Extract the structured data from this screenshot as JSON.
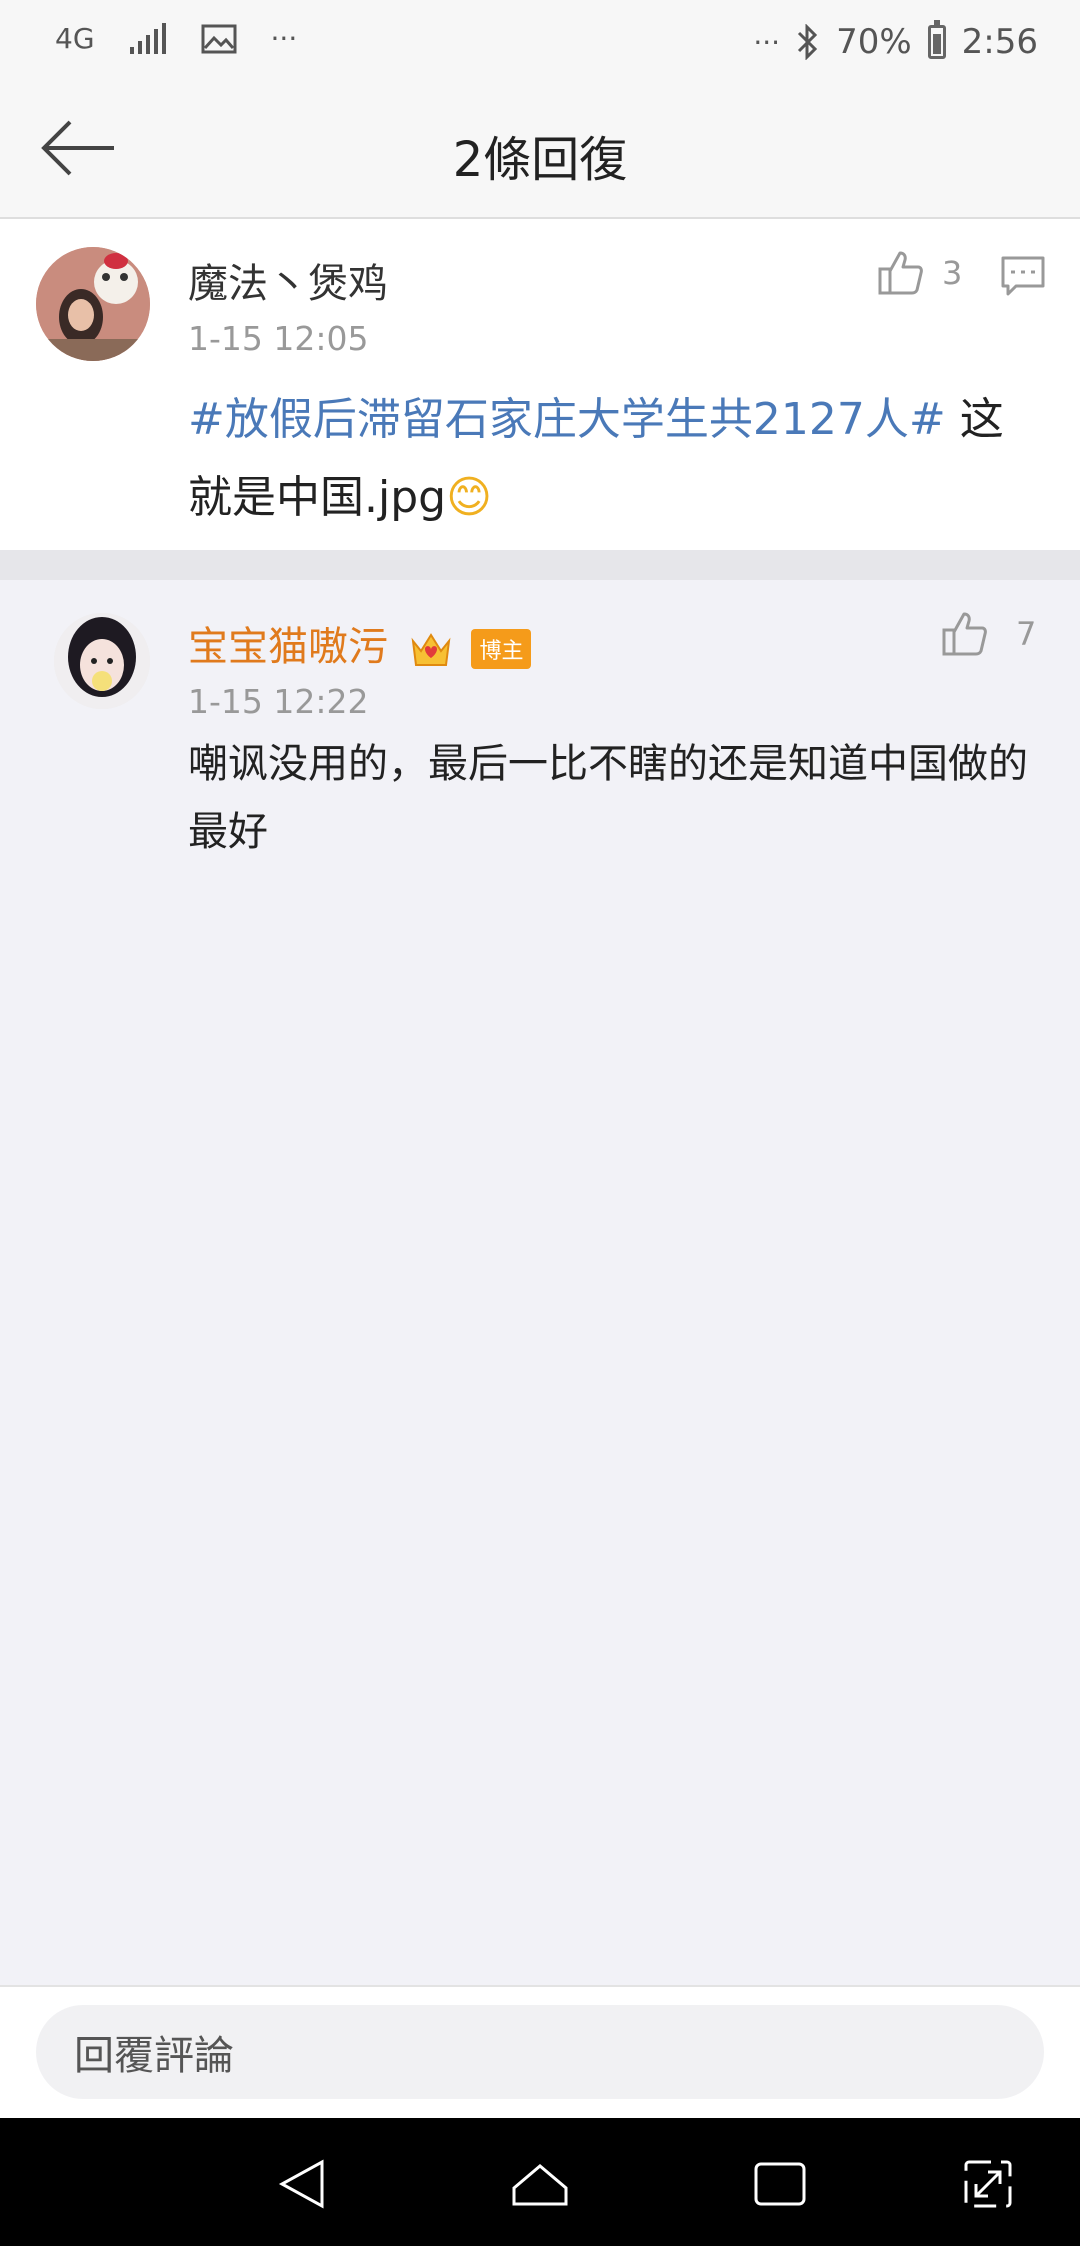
{
  "status_bar": {
    "network": "4G",
    "more": "···",
    "more_right": "···",
    "battery": "70%",
    "battery_level": 0.7,
    "time": "2:56"
  },
  "header": {
    "title": "2條回復"
  },
  "main_comment": {
    "username": "魔法丶煲鸡",
    "timestamp": "1-15 12:05",
    "like_count": "3",
    "hashtag": "#放假后滞留石家庄大学生共2127人#",
    "text": " 这就是中国.jpg",
    "emoji": "😊"
  },
  "reply": {
    "username": "宝宝猫嗷污",
    "badge": "博主",
    "timestamp": "1-15 12:22",
    "like_count": "7",
    "text": "嘲讽没用的，最后一比不瞎的还是知道中国做的最好"
  },
  "input": {
    "placeholder": "回覆評論"
  },
  "colors": {
    "hashtag": "#4a79b8",
    "reply_name": "#e07a1c",
    "badge": "#f59b1a"
  }
}
